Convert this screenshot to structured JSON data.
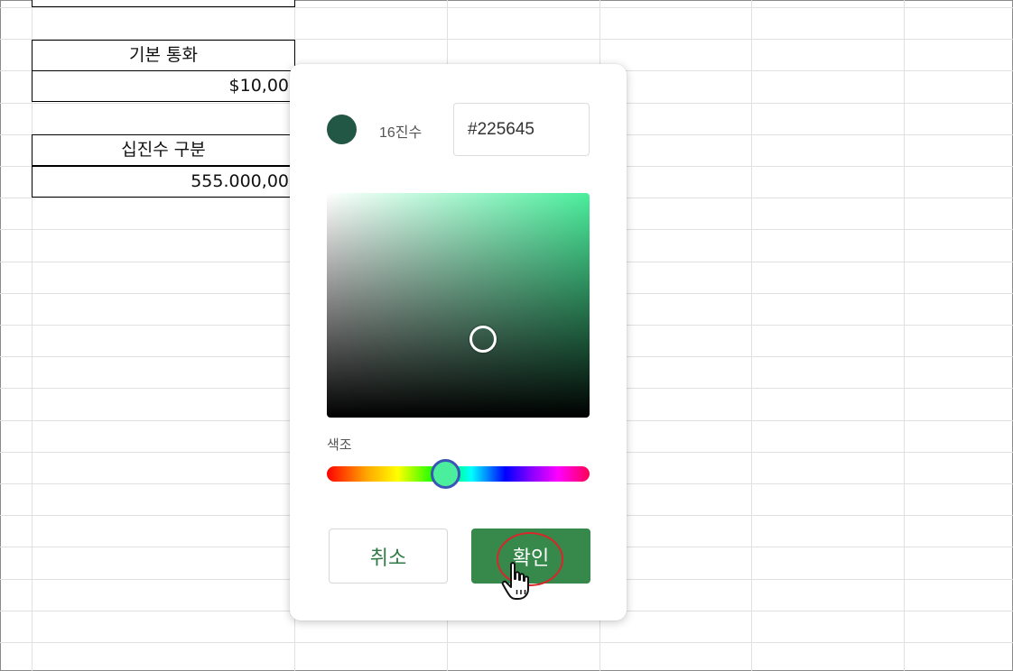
{
  "sheet": {
    "cells": [
      {
        "text": "기본 통화",
        "align": "center"
      },
      {
        "text": "$10,00",
        "align": "right"
      },
      {
        "text": "십진수 구분",
        "align": "center"
      },
      {
        "text": "555.000,00",
        "align": "right"
      }
    ]
  },
  "color_picker": {
    "swatch_color": "#225645",
    "hex_label": "16진수",
    "hex_value": "#225645",
    "hue_label": "색조",
    "hue_handle_color": "#4aee9c",
    "cancel_label": "취소",
    "ok_label": "확인",
    "accent_color": "#36894b"
  },
  "icons": {
    "cursor": "hand-pointer-icon"
  }
}
